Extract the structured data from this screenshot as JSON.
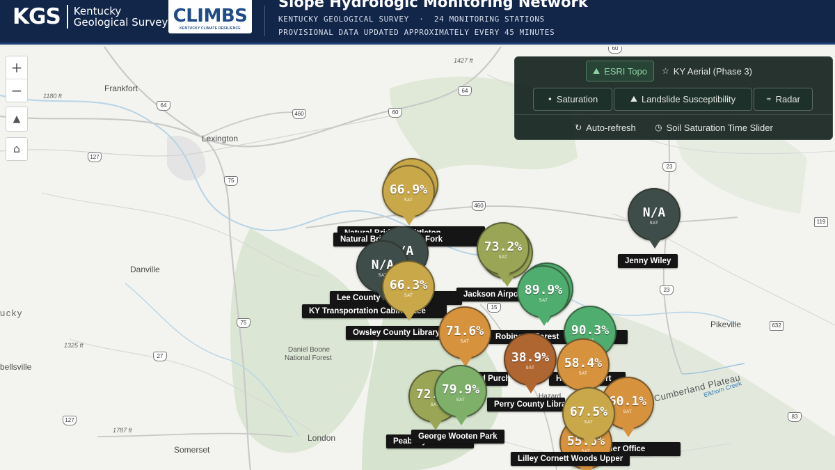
{
  "header": {
    "kgs_letters": "KGS",
    "kgs_line1": "Kentucky",
    "kgs_line2": "Geological Survey",
    "climbs_word": "CLIMBS",
    "climbs_sub": "KENTUCKY CLIMATE RESILIENCE",
    "title": "Slope Hydrologic Monitoring Network",
    "subline1": "KENTUCKY GEOLOGICAL SURVEY  ·  24 MONITORING STATIONS",
    "subline2": "PROVISIONAL DATA UPDATED APPROXIMATELY EVERY 45 MINUTES"
  },
  "controls": {
    "zoom_in": "+",
    "zoom_out": "−",
    "compass": "▲",
    "home": "⌂"
  },
  "panel": {
    "basemap_esri": "ESRI Topo",
    "basemap_aerial": "KY Aerial (Phase 3)",
    "layer_saturation": "Saturation",
    "layer_landslide": "Landslide Susceptibility",
    "layer_radar": "Radar",
    "auto_refresh": "Auto-refresh",
    "time_slider": "Soil Saturation Time Slider"
  },
  "places": {
    "frankfort": "Frankfort",
    "lexington": "Lexington",
    "danville": "Danville",
    "kentucky": "ucky",
    "daniel_boone_1": "Daniel Boone",
    "daniel_boone_2": "National Forest",
    "london": "London",
    "somerset": "Somerset",
    "bellsville": "bellsville",
    "pikeville": "Pikeville",
    "hazard": "Hazard",
    "plateau": "Cumberland Plateau",
    "elkhorn": "Elkhorn Creek",
    "elev_1180": "1180 ft",
    "elev_1427": "1427 ft",
    "elev_1325": "1325 ft",
    "elev_1787": "1787 ft"
  },
  "roads": [
    "60",
    "64",
    "64",
    "460",
    "60",
    "127",
    "75",
    "460",
    "23",
    "119",
    "23",
    "15",
    "632",
    "75",
    "27",
    "127",
    "83"
  ],
  "colors": {
    "na": "#3f4d4a",
    "saturation_high": "#4fae6f",
    "saturation_mid": "#9aa656",
    "saturation_ochre": "#c9a84a",
    "saturation_orange": "#d7923e",
    "saturation_low": "#b06631"
  },
  "stations": [
    {
      "value": "66.9%",
      "sat": "SAT",
      "color": "#c9a84a"
    },
    {
      "value": "N/A",
      "sat": "SAT",
      "color": "#3f4d4a"
    },
    {
      "value": "N/A",
      "sat": "SAT",
      "color": "#3f4d4a"
    },
    {
      "value": "N/A",
      "sat": "SAT",
      "color": "#3f4d4a"
    },
    {
      "value": "66.3%",
      "sat": "SAT",
      "color": "#c9a84a"
    },
    {
      "value": "73.2%",
      "sat": "SAT",
      "color": "#9aa656"
    },
    {
      "value": "89.9%",
      "sat": "SAT",
      "color": "#4fae6f"
    },
    {
      "value": "90.3%",
      "sat": "SAT",
      "color": "#4fae6f"
    },
    {
      "value": "71.6%",
      "sat": "SAT",
      "color": "#d7923e"
    },
    {
      "value": "38.9%",
      "sat": "SAT",
      "color": "#b06631"
    },
    {
      "value": "58.4%",
      "sat": "SAT",
      "color": "#d7923e"
    },
    {
      "value": "72.1%",
      "sat": "SAT",
      "color": "#9aa656"
    },
    {
      "value": "79.9%",
      "sat": "SAT",
      "color": "#7fb06a"
    },
    {
      "value": "60.1%",
      "sat": "SAT",
      "color": "#d7923e"
    },
    {
      "value": "55.6%",
      "sat": "SAT",
      "color": "#d7923e"
    },
    {
      "value": "67.5%",
      "sat": "SAT",
      "color": "#c9a84a"
    }
  ],
  "labels": [
    "Natural Bridge Whittleton",
    "Natural Bridge Middle Fork",
    "Jenny Wiley",
    "Lee County High School",
    "KY Transportation Cabinet Lee",
    "Jackson Airport",
    "Robinson Forest",
    "Owsley County Library",
    "Perry County Library",
    "Red Bird Purchase Unit",
    "Hazard Airport",
    "George Wooten Park",
    "Peabody Mountain",
    "Letcher Office",
    "Lilley Cornett Woods Upper"
  ]
}
